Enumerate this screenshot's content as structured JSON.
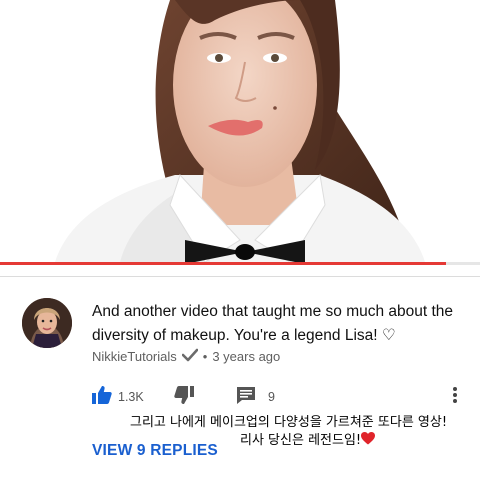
{
  "video": {
    "progress_fraction": 0.93,
    "progress_color": "#e53935"
  },
  "comment": {
    "text": "And another video that taught me so much about the diversity of makeup. You're a legend Lisa! ♡",
    "author": "NikkieTutorials",
    "separator": "•",
    "time": "3 years ago",
    "likes": "1.3K",
    "reply_count": "9",
    "translation_line1": "그리고 나에게 메이크업의 다양성을 가르쳐준 또다른 영상!",
    "translation_line2": "리사 당신은 레전드임!",
    "translation_emoji": "❤️",
    "view_replies_label": "VIEW 9 REPLIES"
  },
  "colors": {
    "accent_blue": "#1a5fcf",
    "like_blue": "#1565d8",
    "heart_red": "#e0242b"
  },
  "icons": [
    "thumbs-up-icon",
    "thumbs-down-icon",
    "comment-icon",
    "more-vert-icon",
    "verified-check-icon"
  ]
}
